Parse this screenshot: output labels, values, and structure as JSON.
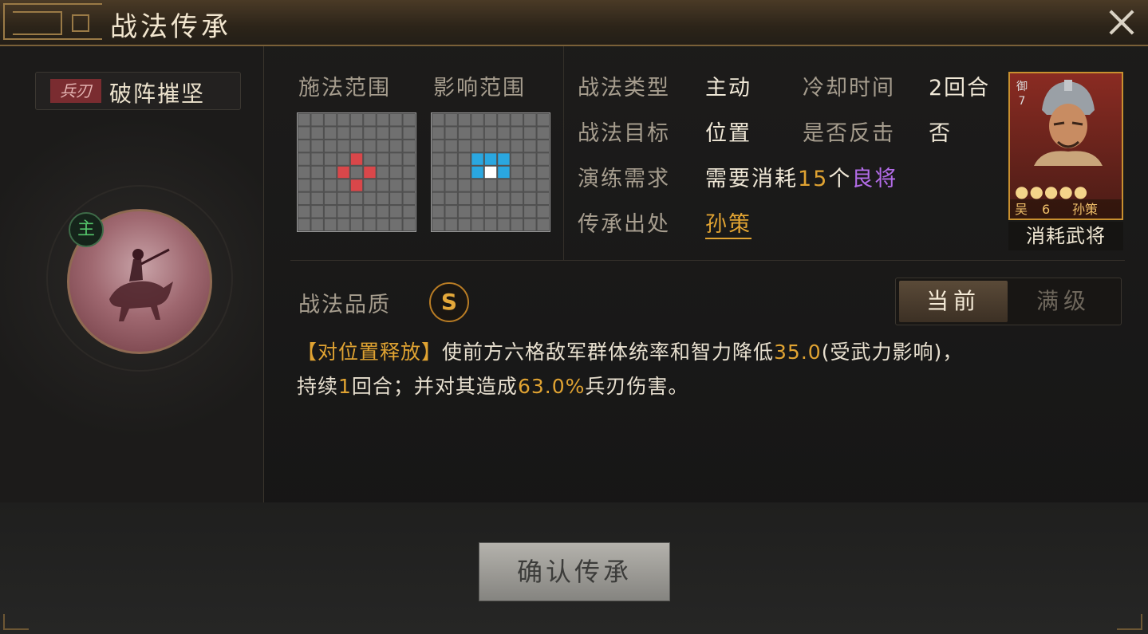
{
  "window": {
    "title": "战法传承",
    "close_icon": "close-icon"
  },
  "skill": {
    "type_badge": "兵刃",
    "name": "破阵摧坚",
    "main_badge": "主"
  },
  "ranges": {
    "cast_label": "施法范围",
    "effect_label": "影响范围",
    "grid_size": 9,
    "cast_cells": [
      [
        4,
        3
      ],
      [
        3,
        4
      ],
      [
        5,
        4
      ],
      [
        4,
        5
      ]
    ],
    "effect_cells": [
      [
        3,
        3
      ],
      [
        4,
        3
      ],
      [
        5,
        3
      ],
      [
        3,
        4
      ],
      [
        5,
        4
      ]
    ],
    "effect_self_cell": [
      4,
      4
    ],
    "cast_color": "#d9474a",
    "effect_color": "#2aa7e0"
  },
  "info": {
    "type_label": "战法类型",
    "type_value": "主动",
    "cooldown_label": "冷却时间",
    "cooldown_value": "2回合",
    "target_label": "战法目标",
    "target_value": "位置",
    "counter_label": "是否反击",
    "counter_value": "否",
    "train_label": "演练需求",
    "train_prefix": "需要消耗",
    "train_count": "15",
    "train_mid": "个",
    "train_general": "良将",
    "source_label": "传承出处",
    "source_value": "孙策"
  },
  "card": {
    "side_text": "御7",
    "stars": "●●●●●",
    "faction": "吴",
    "cost": "6",
    "name": "孙策",
    "label": "消耗武将"
  },
  "quality": {
    "label": "战法品质",
    "grade": "S"
  },
  "tabs": {
    "current": "当前",
    "max": "满级"
  },
  "description": {
    "tag": "【对位置释放】",
    "part1": "使前方六格敌军群体统率和智力降低",
    "value1": "35.0",
    "part2": "(受武力影响)，",
    "part3": "持续",
    "turns": "1",
    "part4": "回合；并对其造成",
    "value2": "63.0%",
    "part5": "兵刃伤害。"
  },
  "confirm_button": "确认传承"
}
